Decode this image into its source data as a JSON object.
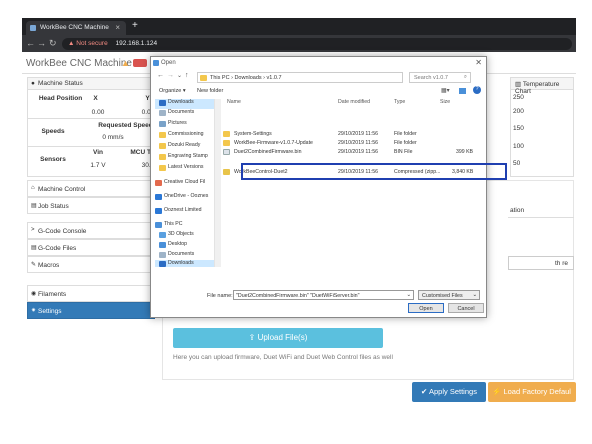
{
  "browser": {
    "tab_title": "WorkBee CNC Machine",
    "tab_close": "×",
    "new_tab": "+",
    "not_secure": "Not secure",
    "address": "192.168.1.124"
  },
  "app": {
    "title": "WorkBee CNC Machine",
    "machine_status": {
      "heading": "Machine Status",
      "head_position_label": "Head Position",
      "axes": [
        "X",
        "Y"
      ],
      "axis_values": [
        "0.00",
        "0.00"
      ],
      "speeds_label": "Speeds",
      "requested_speed_label": "Requested Speed",
      "requested_speed_value": "0 mm/s",
      "speed_extra": "T",
      "sensors_label": "Sensors",
      "vin_label": "Vin",
      "vin_value": "1.7 V",
      "mcu_label": "MCU Temp.",
      "mcu_value": "30.2"
    },
    "temperature_chart": {
      "heading": "Temperature Chart",
      "ticks": [
        "250",
        "200",
        "150",
        "100",
        "50"
      ]
    },
    "sidebar": [
      {
        "label": "Machine Control",
        "icon": "home-icon"
      },
      {
        "label": "Job Status",
        "icon": "file-icon"
      },
      {
        "label": "G-Code Console",
        "icon": "console-icon"
      },
      {
        "label": "G-Code Files",
        "icon": "files-icon"
      },
      {
        "label": "Macros",
        "icon": "macro-icon"
      },
      {
        "label": "Filaments",
        "icon": "filament-icon"
      },
      {
        "label": "Settings",
        "icon": "gear-icon"
      }
    ],
    "right_fragments": {
      "ation": "ation",
      "th": "th re"
    },
    "upload_button": "Upload File(s)",
    "upload_help": "Here you can upload firmware, Duet WiFi and Duet Web Control files as well",
    "apply_button": "Apply Settings",
    "factory_button": "Load Factory Defaul"
  },
  "dialog": {
    "title": "Open",
    "breadcrumb": "This PC  ›  Downloads  ›  v1.0.7",
    "search_placeholder": "Search v1.0.7",
    "organize": "Organize ▾",
    "new_folder": "New folder",
    "tree": [
      {
        "label": "Downloads",
        "icon": "download-icon",
        "color": "#2b6cc4"
      },
      {
        "label": "Documents",
        "icon": "document-icon",
        "color": "#9fb4c8"
      },
      {
        "label": "Pictures",
        "icon": "picture-icon",
        "color": "#7aa2c8"
      },
      {
        "label": "Commissioning",
        "icon": "folder-icon",
        "color": "#f3c74c"
      },
      {
        "label": "Dozuki Ready",
        "icon": "folder-icon",
        "color": "#f3c74c"
      },
      {
        "label": "Engraving Stamp",
        "icon": "folder-icon",
        "color": "#f3c74c"
      },
      {
        "label": "Latest Versions",
        "icon": "folder-icon",
        "color": "#f3c74c"
      },
      {
        "label": "Creative Cloud Fil",
        "icon": "cloud-icon",
        "color": "#e36a4d"
      },
      {
        "label": "OneDrive - Ooznes",
        "icon": "cloud-icon",
        "color": "#2b78d6"
      },
      {
        "label": "Ooznest Limited",
        "icon": "building-icon",
        "color": "#2b78d6"
      },
      {
        "label": "This PC",
        "icon": "computer-icon",
        "color": "#4a90d9"
      },
      {
        "label": "3D Objects",
        "icon": "cube-icon",
        "color": "#5aa0e0"
      },
      {
        "label": "Desktop",
        "icon": "desktop-icon",
        "color": "#4a90d9"
      },
      {
        "label": "Documents",
        "icon": "document-icon",
        "color": "#9fb4c8"
      },
      {
        "label": "Downloads",
        "icon": "download-icon",
        "color": "#2b6cc4"
      }
    ],
    "columns": [
      "Name",
      "Date modified",
      "Type",
      "Size"
    ],
    "files": [
      {
        "name": "System-Settings",
        "date": "29/10/2019 11:56",
        "type": "File folder",
        "size": "",
        "icon": "folder-icon",
        "color": "#f3c74c"
      },
      {
        "name": "WorkBee-Firmware-v1.0.7-Update",
        "date": "29/10/2019 11:56",
        "type": "File folder",
        "size": "",
        "icon": "folder-icon",
        "color": "#f3c74c"
      },
      {
        "name": "Duet2CombinedFirmware.bin",
        "date": "29/10/2019 11:56",
        "type": "BIN File",
        "size": "399 KB",
        "icon": "file-icon",
        "color": "#dde3ea"
      },
      {
        "name": "WorkBeeControl-Duet2",
        "date": "29/10/2019 11:56",
        "type": "Compressed (zipp...",
        "size": "3,840 KB",
        "icon": "zip-icon",
        "color": "#e8c44a"
      }
    ],
    "filename_label": "File name:",
    "filename_value": "\"Duet2CombinedFirmware.bin\" \"DuetWiFiServer.bin\"",
    "filter": "Customised Files",
    "open_button": "Open",
    "cancel_button": "Cancel"
  }
}
